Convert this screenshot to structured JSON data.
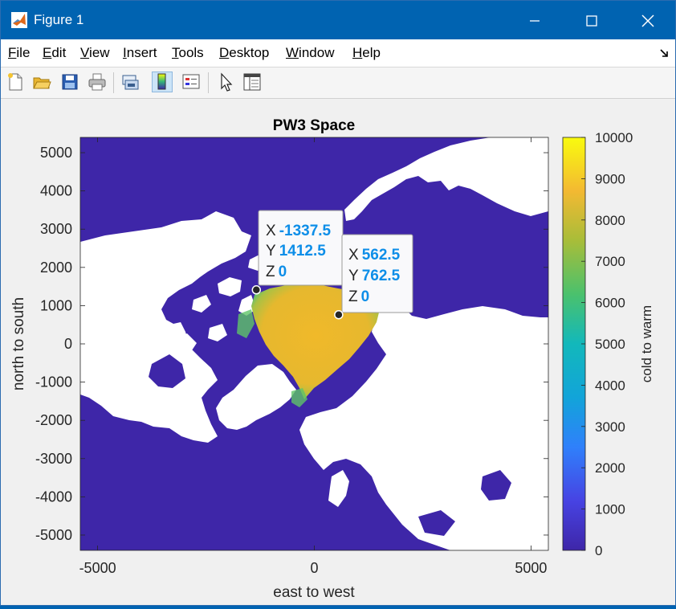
{
  "window": {
    "title": "Figure 1"
  },
  "menu": [
    {
      "key": "F",
      "rest": "ile"
    },
    {
      "key": "E",
      "rest": "dit"
    },
    {
      "key": "V",
      "rest": "iew"
    },
    {
      "key": "I",
      "rest": "nsert"
    },
    {
      "key": "T",
      "rest": "ools"
    },
    {
      "key": "D",
      "rest": "esktop"
    },
    {
      "key": "W",
      "rest": "indow"
    },
    {
      "key": "H",
      "rest": "elp"
    }
  ],
  "toolbar": {
    "icons": [
      "new-figure-icon",
      "open-file-icon",
      "save-icon",
      "print-icon",
      "link-plot-icon",
      "colorbar-icon",
      "legend-icon",
      "edit-plot-icon",
      "property-inspector-icon"
    ]
  },
  "chart_data": {
    "type": "heatmap",
    "title": "PW3 Space",
    "xlabel": "east to west",
    "ylabel": "north to south",
    "xlim": [
      -5400,
      5400
    ],
    "ylim": [
      -5400,
      5400
    ],
    "xticks": [
      -5000,
      0,
      5000
    ],
    "xtick_labels": [
      "-5000",
      "0",
      "5000"
    ],
    "yticks": [
      5000,
      4000,
      3000,
      2000,
      1000,
      0,
      -1000,
      -2000,
      -3000,
      -4000,
      -5000
    ],
    "ytick_labels": [
      "5000",
      "4000",
      "3000",
      "2000",
      "1000",
      "0",
      "-1000",
      "-2000",
      "-3000",
      "-4000",
      "-5000"
    ],
    "colorbar": {
      "label": "cold to warm",
      "clim": [
        0,
        10000
      ],
      "ticks": [
        10000,
        9000,
        8000,
        7000,
        6000,
        5000,
        4000,
        3000,
        2000,
        1000,
        0
      ],
      "tick_labels": [
        "10000",
        "9000",
        "8000",
        "7000",
        "6000",
        "5000",
        "4000",
        "3000",
        "2000",
        "1000",
        "0"
      ],
      "colormap": "parula"
    },
    "ocean_value": 0,
    "land_value": null,
    "ice_value_range": [
      6000,
      9200
    ],
    "datatips": [
      {
        "x_label": "X",
        "x": "-1337.5",
        "y_label": "Y",
        "y": "1412.5",
        "z_label": "Z",
        "z": "0"
      },
      {
        "x_label": "X",
        "x": "562.5",
        "y_label": "Y",
        "y": "762.5",
        "z_label": "Z",
        "z": "0"
      }
    ],
    "colors": {
      "ocean": "#3e26a8",
      "land": "#ffffff",
      "ice": "#f0b92a",
      "datatip_value": "#0d8ee8"
    }
  }
}
